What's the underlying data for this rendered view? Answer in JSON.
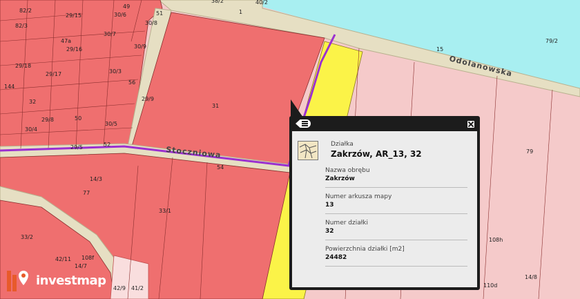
{
  "map": {
    "street_name": "Odolanowska",
    "street_name_2": "Stoczniowa",
    "parcel_labels": [
      "82/2",
      "29/15",
      "49",
      "51",
      "30/6",
      "30/8",
      "38/2",
      "40/2",
      "1",
      "82/3",
      "47a",
      "30/7",
      "29/16",
      "30/9",
      "79/2",
      "15",
      "29/18",
      "29/17",
      "30/3",
      "56",
      "144",
      "29/9",
      "31",
      "32",
      "29/8",
      "50",
      "30/5",
      "30/4",
      "29/5",
      "52",
      "54",
      "79",
      "14/3",
      "77",
      "33/1",
      "33/2",
      "42/11",
      "108f",
      "108h",
      "14/7",
      "42/9",
      "41/2",
      "110d",
      "14/8",
      "14/1"
    ]
  },
  "popup": {
    "type_label": "Działka",
    "title": "Zakrzów, AR_13, 32",
    "fields": [
      {
        "key": "Nazwa obrębu",
        "value": "Zakrzów"
      },
      {
        "key": "Numer arkusza mapy",
        "value": "13"
      },
      {
        "key": "Numer działki",
        "value": "32"
      },
      {
        "key": "Powierzchnia działki [m2]",
        "value": "24482"
      }
    ]
  },
  "logo": {
    "text": "investmap"
  },
  "colors": {
    "parcel": "#f07070",
    "light_parcel": "#f7c8c8",
    "road": "#e8e0c4",
    "water": "#a7eef0",
    "yellow": "#fbf348",
    "route": "#9b30d0"
  }
}
